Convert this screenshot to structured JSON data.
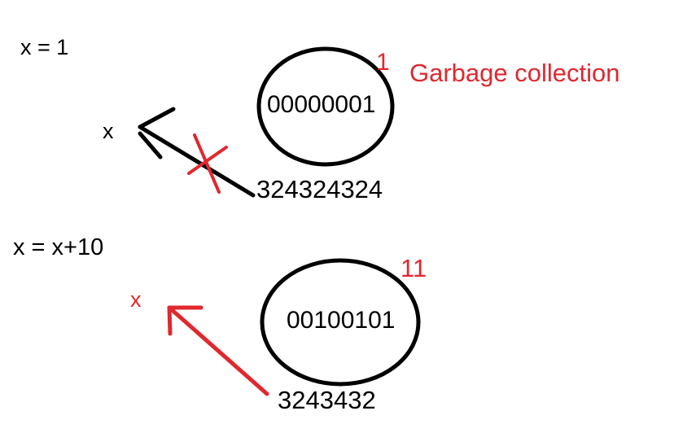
{
  "colors": {
    "ink": "#000000",
    "annotation": "#e0282e",
    "background": "#ffffff"
  },
  "scene1": {
    "statement": "x = 1",
    "variable": "x",
    "value_binary": "00000001",
    "value_decimal": "1",
    "address": "324324324",
    "note": "Garbage collection",
    "reference_state": "crossed-out"
  },
  "scene2": {
    "statement": "x = x+10",
    "variable": "x",
    "value_binary": "00100101",
    "value_decimal": "11",
    "address": "3243432",
    "reference_state": "active"
  }
}
